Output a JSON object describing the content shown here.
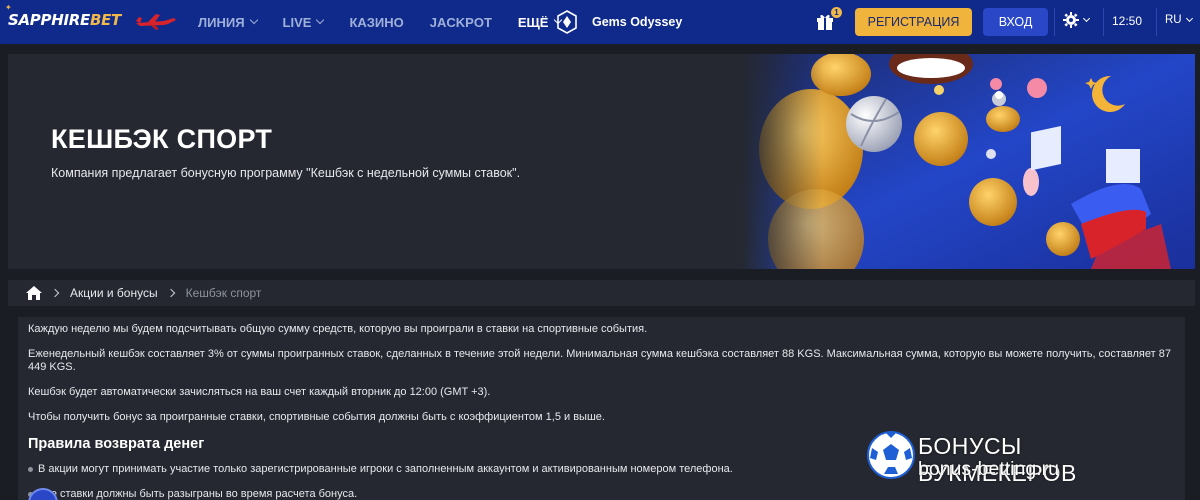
{
  "header": {
    "logo_part1": "SAPPHIRE",
    "logo_part2": "BET",
    "aviator_icon": "plane-icon",
    "nav": [
      {
        "label": "ЛИНИЯ",
        "dropdown": true
      },
      {
        "label": "LIVE",
        "dropdown": true
      },
      {
        "label": "КАЗИНО",
        "dropdown": false
      },
      {
        "label": "JACKPOT",
        "dropdown": false
      },
      {
        "label": "ЕЩЁ",
        "dropdown": true
      }
    ],
    "gems_label": "Gems Odyssey",
    "gift_badge": "1",
    "register_label": "РЕГИСТРАЦИЯ",
    "login_label": "ВХОД",
    "time": "12:50",
    "language": "RU",
    "colors": {
      "bar": "#102a8c",
      "register": "#f0b43c",
      "login": "#2a47c8"
    }
  },
  "banner": {
    "title": "КЕШБЭК СПОРТ",
    "subtitle": "Компания предлагает бонусную программу \"Кешбэк с недельной суммы ставок\"."
  },
  "breadcrumb": {
    "home_icon": "home-icon",
    "link": "Акции и бонусы",
    "current": "Кешбэк спорт"
  },
  "content": {
    "paragraphs": [
      "Каждую неделю мы будем подсчитывать общую сумму средств, которую вы проиграли в ставки на спортивные события.",
      "Еженедельный кешбэк составляет 3% от суммы проигранных ставок, сделанных в течение этой недели. Минимальная сумма кешбэка составляет 88 KGS. Максимальная сумма, которую вы можете получить, составляет 87 449 KGS.",
      "Кешбэк будет автоматически зачисляться на ваш счет каждый вторник до 12:00 (GMT +3).",
      "Чтобы получить бонус за проигранные ставки, спортивные события должны быть с коэффициентом 1,5 и выше."
    ],
    "rules_title": "Правила возврата денег",
    "rules": [
      "В акции могут принимать участие только зарегистрированные игроки с заполненным аккаунтом и активированным номером телефона.",
      "Все ставки должны быть разыграны во время расчета бонуса."
    ]
  },
  "watermark": {
    "line1": "БОНУСЫ БУКМЕКЕРОВ",
    "line2": "bonus-betting.ru"
  }
}
